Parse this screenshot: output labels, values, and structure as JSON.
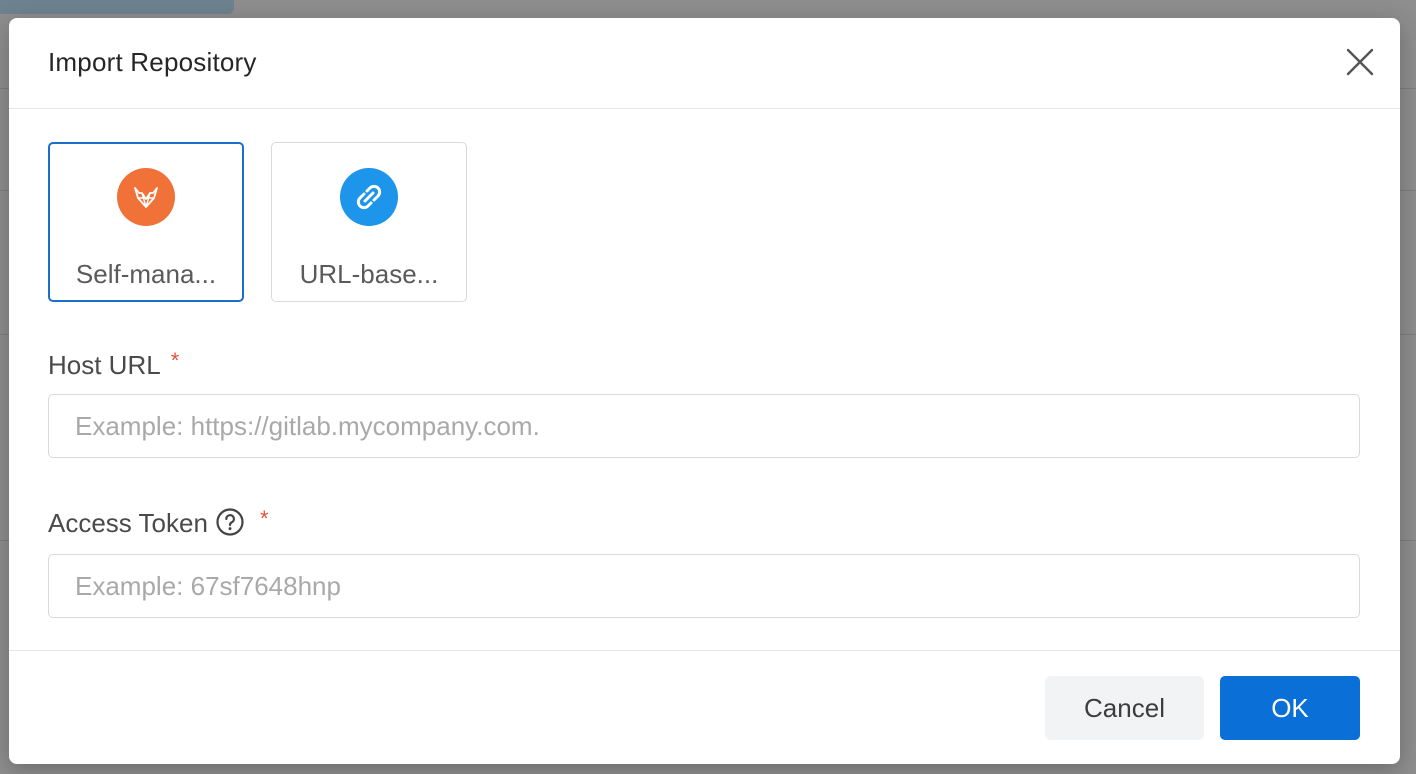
{
  "dialog": {
    "title": "Import Repository",
    "close_icon": "close-icon"
  },
  "sources": [
    {
      "label": "Self-mana...",
      "icon": "gitlab-icon",
      "icon_color": "#f07238",
      "selected": true
    },
    {
      "label": "URL-base...",
      "icon": "link-icon",
      "icon_color": "#1c95ea",
      "selected": false
    }
  ],
  "form": {
    "host_url": {
      "label": "Host URL",
      "required_mark": "*",
      "value": "",
      "placeholder": "Example: https://gitlab.mycompany.com."
    },
    "access_token": {
      "label": "Access Token",
      "help_icon": "question-circle-icon",
      "required_mark": "*",
      "value": "",
      "placeholder": "Example: 67sf7648hnp"
    }
  },
  "footer": {
    "cancel_label": "Cancel",
    "ok_label": "OK"
  },
  "colors": {
    "primary": "#0a6fd6",
    "selected_border": "#1b6fc9",
    "required": "#e5533b",
    "overlay": "#8e8e8e"
  }
}
